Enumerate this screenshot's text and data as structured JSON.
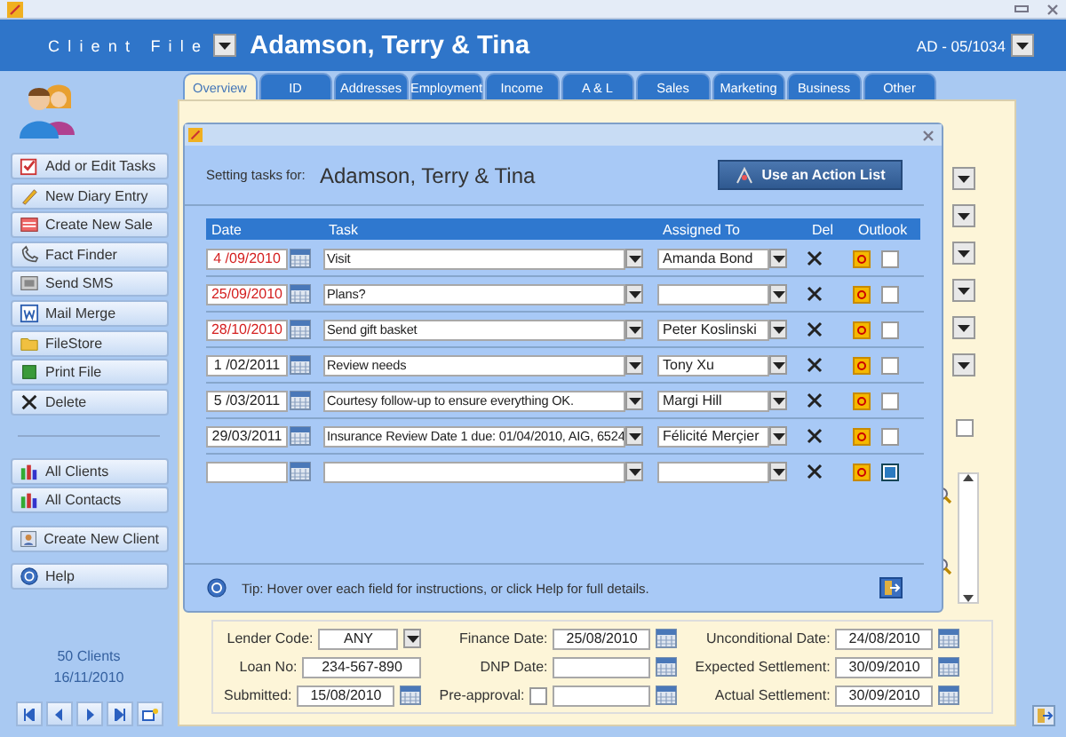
{
  "header": {
    "title": "Client File",
    "client_name": "Adamson, Terry & Tina",
    "client_code": "AD - 05/1034"
  },
  "tabs": [
    {
      "label": "Overview",
      "selected": true
    },
    {
      "label": "ID",
      "selected": false
    },
    {
      "label": "Addresses",
      "selected": false
    },
    {
      "label": "Employment",
      "selected": false
    },
    {
      "label": "Income",
      "selected": false
    },
    {
      "label": "A & L",
      "selected": false
    },
    {
      "label": "Sales",
      "selected": false
    },
    {
      "label": "Marketing",
      "selected": false
    },
    {
      "label": "Business",
      "selected": false
    },
    {
      "label": "Other",
      "selected": false
    }
  ],
  "sidebar": {
    "groups": [
      [
        "Add or Edit Tasks",
        "New Diary Entry",
        "Create New Sale",
        "Fact Finder",
        "Send SMS",
        "Mail Merge",
        "FileStore",
        "Print File",
        "Delete"
      ],
      [
        "All Clients",
        "All Contacts"
      ],
      [
        "Create New Client"
      ],
      [
        "Help"
      ]
    ],
    "client_count": "50 Clients",
    "date": "16/11/2010"
  },
  "dialog": {
    "setting_label": "Setting tasks for:",
    "client_name": "Adamson, Terry & Tina",
    "action_button": "Use an Action List",
    "columns": [
      "Date",
      "Task",
      "Assigned To",
      "Del",
      "Outlook"
    ],
    "rows": [
      {
        "date": "4 /09/2010",
        "overdue": true,
        "task": "Visit",
        "assigned_to": "Amanda Bond",
        "outlook_checked": false
      },
      {
        "date": "25/09/2010",
        "overdue": true,
        "task": "Plans?",
        "outlook_checked": false
      },
      {
        "date": "28/10/2010",
        "overdue": true,
        "task": "Send gift basket",
        "assigned_to": "Peter Koslinski",
        "outlook_checked": false
      },
      {
        "date": "1 /02/2011",
        "overdue": false,
        "task": "Review needs",
        "assigned_to": "Tony Xu",
        "outlook_checked": false
      },
      {
        "date": "5 /03/2011",
        "overdue": false,
        "task": "Courtesy follow-up to ensure everything OK.",
        "assigned_to": "Margi Hill",
        "outlook_checked": false
      },
      {
        "date": "29/03/2011",
        "overdue": false,
        "task": "Insurance Review Date 1 due: 01/04/2010, AIG, 6524",
        "assigned_to": "Félicité Merçier",
        "outlook_checked": false
      },
      {
        "overdue": false,
        "outlook_checked": true
      }
    ],
    "tip": "Tip: Hover over each field for instructions, or click Help for full details."
  },
  "overview_checkbox": {
    "checked": false
  },
  "loan_form": {
    "lender_code": {
      "label": "Lender Code:",
      "value": "ANY"
    },
    "loan_no": {
      "label": "Loan No:",
      "value": "234-567-890"
    },
    "submitted": {
      "label": "Submitted:",
      "value": "15/08/2010"
    },
    "finance_date": {
      "label": "Finance Date:",
      "value": "25/08/2010"
    },
    "dnp_date": {
      "label": "DNP Date:"
    },
    "pre_approval": {
      "label": "Pre-approval:",
      "checked": false
    },
    "unconditional_date": {
      "label": "Unconditional Date:",
      "value": "24/08/2010"
    },
    "expected_settlement": {
      "label": "Expected Settlement:",
      "value": "30/09/2010"
    },
    "actual_settlement": {
      "label": "Actual Settlement:",
      "value": "30/09/2010"
    }
  }
}
